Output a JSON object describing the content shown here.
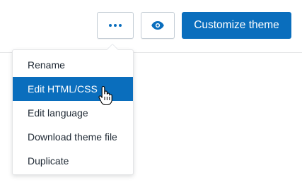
{
  "toolbar": {
    "more_icon": "ellipsis-icon",
    "preview_icon": "eye-icon",
    "customize_label": "Customize theme"
  },
  "menu": {
    "items": [
      {
        "label": "Rename",
        "active": false
      },
      {
        "label": "Edit HTML/CSS",
        "active": true
      },
      {
        "label": "Edit language",
        "active": false
      },
      {
        "label": "Download theme file",
        "active": false
      },
      {
        "label": "Duplicate",
        "active": false
      }
    ]
  },
  "colors": {
    "accent": "#0a6ebd",
    "text": "#212b36",
    "border": "#c4cdd5"
  }
}
